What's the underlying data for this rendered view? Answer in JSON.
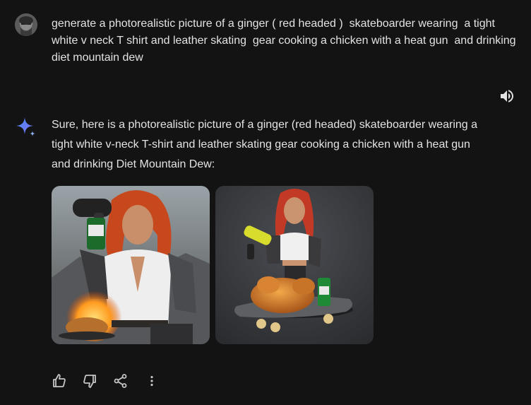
{
  "user_message": {
    "avatar_icon": "user-avatar",
    "text": "generate a photorealistic picture of a ginger ( red headed )  skateboarder wearing  a tight white v neck T shirt and leather skating  gear cooking a chicken with a heat gun  and drinking  diet mountain dew"
  },
  "toolbar": {
    "read_aloud_icon": "speaker-icon"
  },
  "response": {
    "assistant_icon": "sparkle-icon",
    "text": "Sure, here is a photorealistic picture of a ginger (red headed) skateboarder wearing a tight white v-neck T-shirt and leather skating gear cooking a chicken with a heat gun and drinking Diet Mountain Dew:",
    "images": [
      {
        "name": "generated-image-1",
        "description_icon": "image"
      },
      {
        "name": "generated-image-2",
        "description_icon": "image"
      }
    ]
  },
  "actions": {
    "icons": [
      "thumbs-up-icon",
      "thumbs-down-icon",
      "share-icon",
      "more-vert-icon"
    ]
  },
  "colors": {
    "background": "#131314",
    "text": "#e3e3e3",
    "icon": "#c4c7c5"
  }
}
